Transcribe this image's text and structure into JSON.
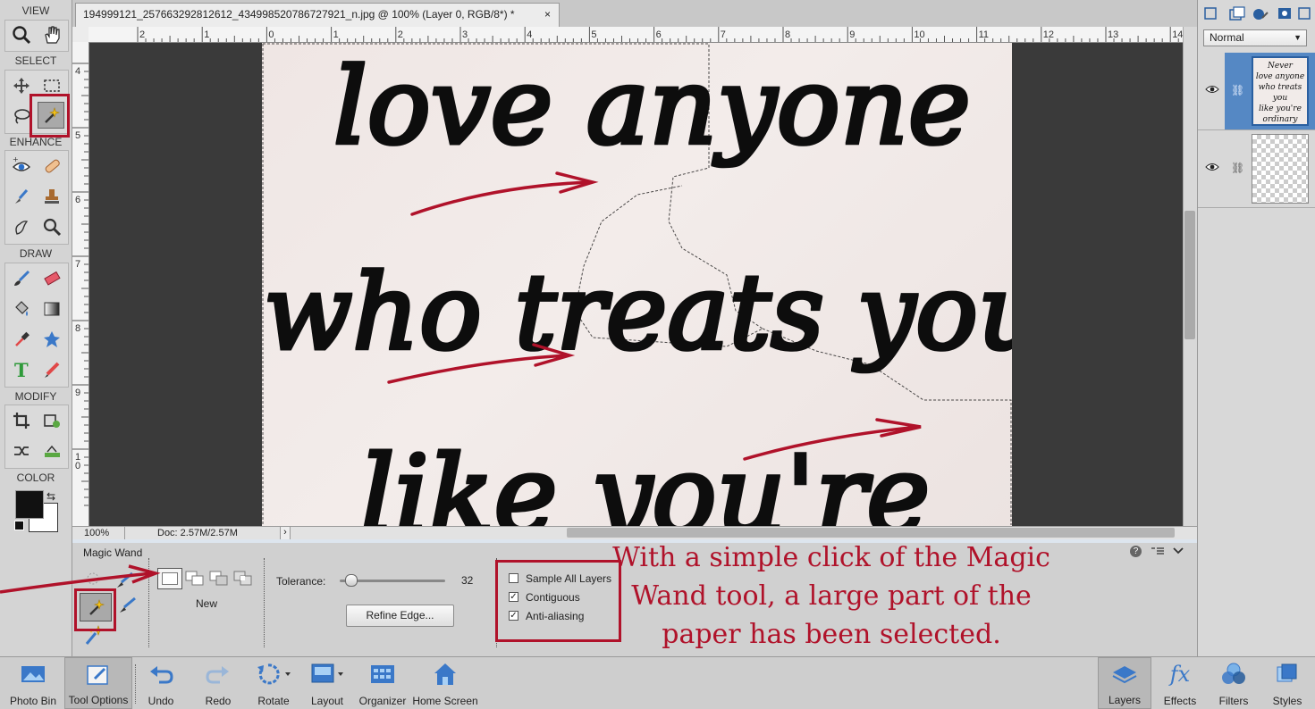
{
  "colors": {
    "accent_red": "#b0122a",
    "selection_blue": "#4f86c6"
  },
  "document": {
    "tab_title": "194999121_257663292812612_434998520786727921_n.jpg @ 100% (Layer 0, RGB/8*) *",
    "close": "×"
  },
  "toolbox": {
    "sections": [
      "VIEW",
      "SELECT",
      "ENHANCE",
      "DRAW",
      "MODIFY",
      "COLOR"
    ],
    "tools": {
      "view": [
        "zoom-icon",
        "hand-icon"
      ],
      "select": [
        "move-icon",
        "marquee-icon",
        "lasso-icon",
        "magic-wand-icon"
      ],
      "enhance": [
        "red-eye-icon",
        "spot-healing-icon",
        "smart-brush-icon",
        "clone-stamp-icon",
        "blur-icon",
        "sponge-icon"
      ],
      "draw": [
        "brush-icon",
        "eraser-icon",
        "paint-bucket-icon",
        "gradient-icon",
        "eyedropper-icon",
        "custom-shape-icon",
        "type-icon",
        "pencil-icon"
      ],
      "modify": [
        "crop-icon",
        "recompose-icon",
        "content-aware-move-icon",
        "straighten-icon"
      ]
    }
  },
  "rulers": {
    "h": [
      "2",
      "1",
      "0",
      "1",
      "2",
      "3",
      "4",
      "5",
      "6",
      "7",
      "8",
      "9",
      "10",
      "11",
      "12",
      "13",
      "14"
    ],
    "v": [
      "4",
      "5",
      "6",
      "7",
      "8",
      "9",
      "1\n0"
    ]
  },
  "status": {
    "zoom": "100%",
    "doc": "Doc: 2.57M/2.57M",
    "arrow": "›"
  },
  "artwork_text": [
    "love anyone",
    "who treats you",
    "like you're"
  ],
  "options": {
    "tool_name": "Magic Wand",
    "mode_label": "New",
    "tolerance_label": "Tolerance:",
    "tolerance_value": "32",
    "refine_button": "Refine Edge...",
    "checkboxes": [
      {
        "label": "Sample All Layers",
        "checked": false
      },
      {
        "label": "Contiguous",
        "checked": true
      },
      {
        "label": "Anti-aliasing",
        "checked": true
      }
    ],
    "annotation_lines": [
      "With a simple click of the Magic",
      "Wand tool, a large part of the",
      "paper has been selected."
    ]
  },
  "layers_panel": {
    "blend_mode": "Normal",
    "thumb_text": [
      "Never",
      "love anyone",
      "who treats you",
      "like you're",
      "ordinary"
    ]
  },
  "taskbar": {
    "left": [
      "Photo Bin",
      "Tool Options",
      "Undo",
      "Redo",
      "Rotate",
      "Layout",
      "Organizer",
      "Home Screen"
    ],
    "right": [
      "Layers",
      "Effects",
      "Filters",
      "Styles"
    ],
    "fx_glyph": "fx"
  }
}
